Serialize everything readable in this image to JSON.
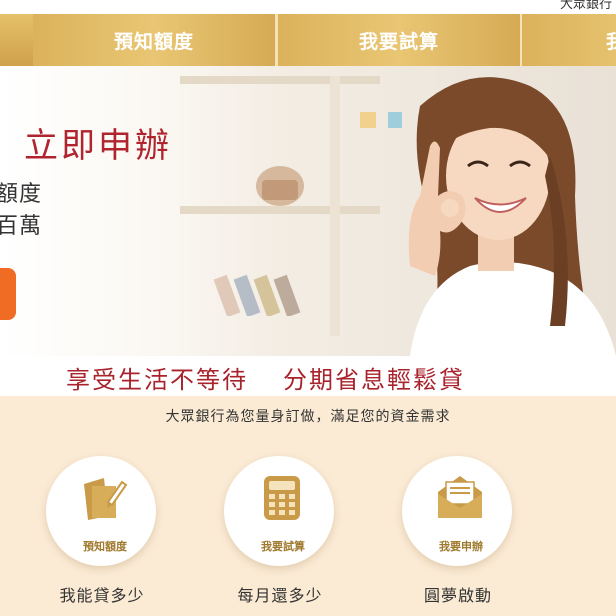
{
  "top_bar": {
    "bank_name_partial": "大眾銀行"
  },
  "nav": {
    "tabs": [
      {
        "label": "預知額度"
      },
      {
        "label": "我要試算"
      },
      {
        "label": "我"
      }
    ]
  },
  "hero": {
    "title": "立即申辦",
    "line1": "額度",
    "line2": "百萬"
  },
  "slogan": {
    "part1": "享受生活不等待",
    "part2": "分期省息輕鬆貸"
  },
  "section": {
    "subtitle": "大眾銀行為您量身訂做，滿足您的資金需求",
    "features": [
      {
        "caption": "預知額度",
        "label": "我能貸多少",
        "icon": "document-pen-icon"
      },
      {
        "caption": "我要試算",
        "label": "每月還多少",
        "icon": "calculator-icon"
      },
      {
        "caption": "我要申辦",
        "label": "圓夢啟動",
        "icon": "envelope-icon"
      }
    ]
  },
  "colors": {
    "gold": "#dcb25c",
    "brand_red": "#b0242e",
    "orange_button": "#f06b23",
    "cream_background": "#fbebd5"
  }
}
